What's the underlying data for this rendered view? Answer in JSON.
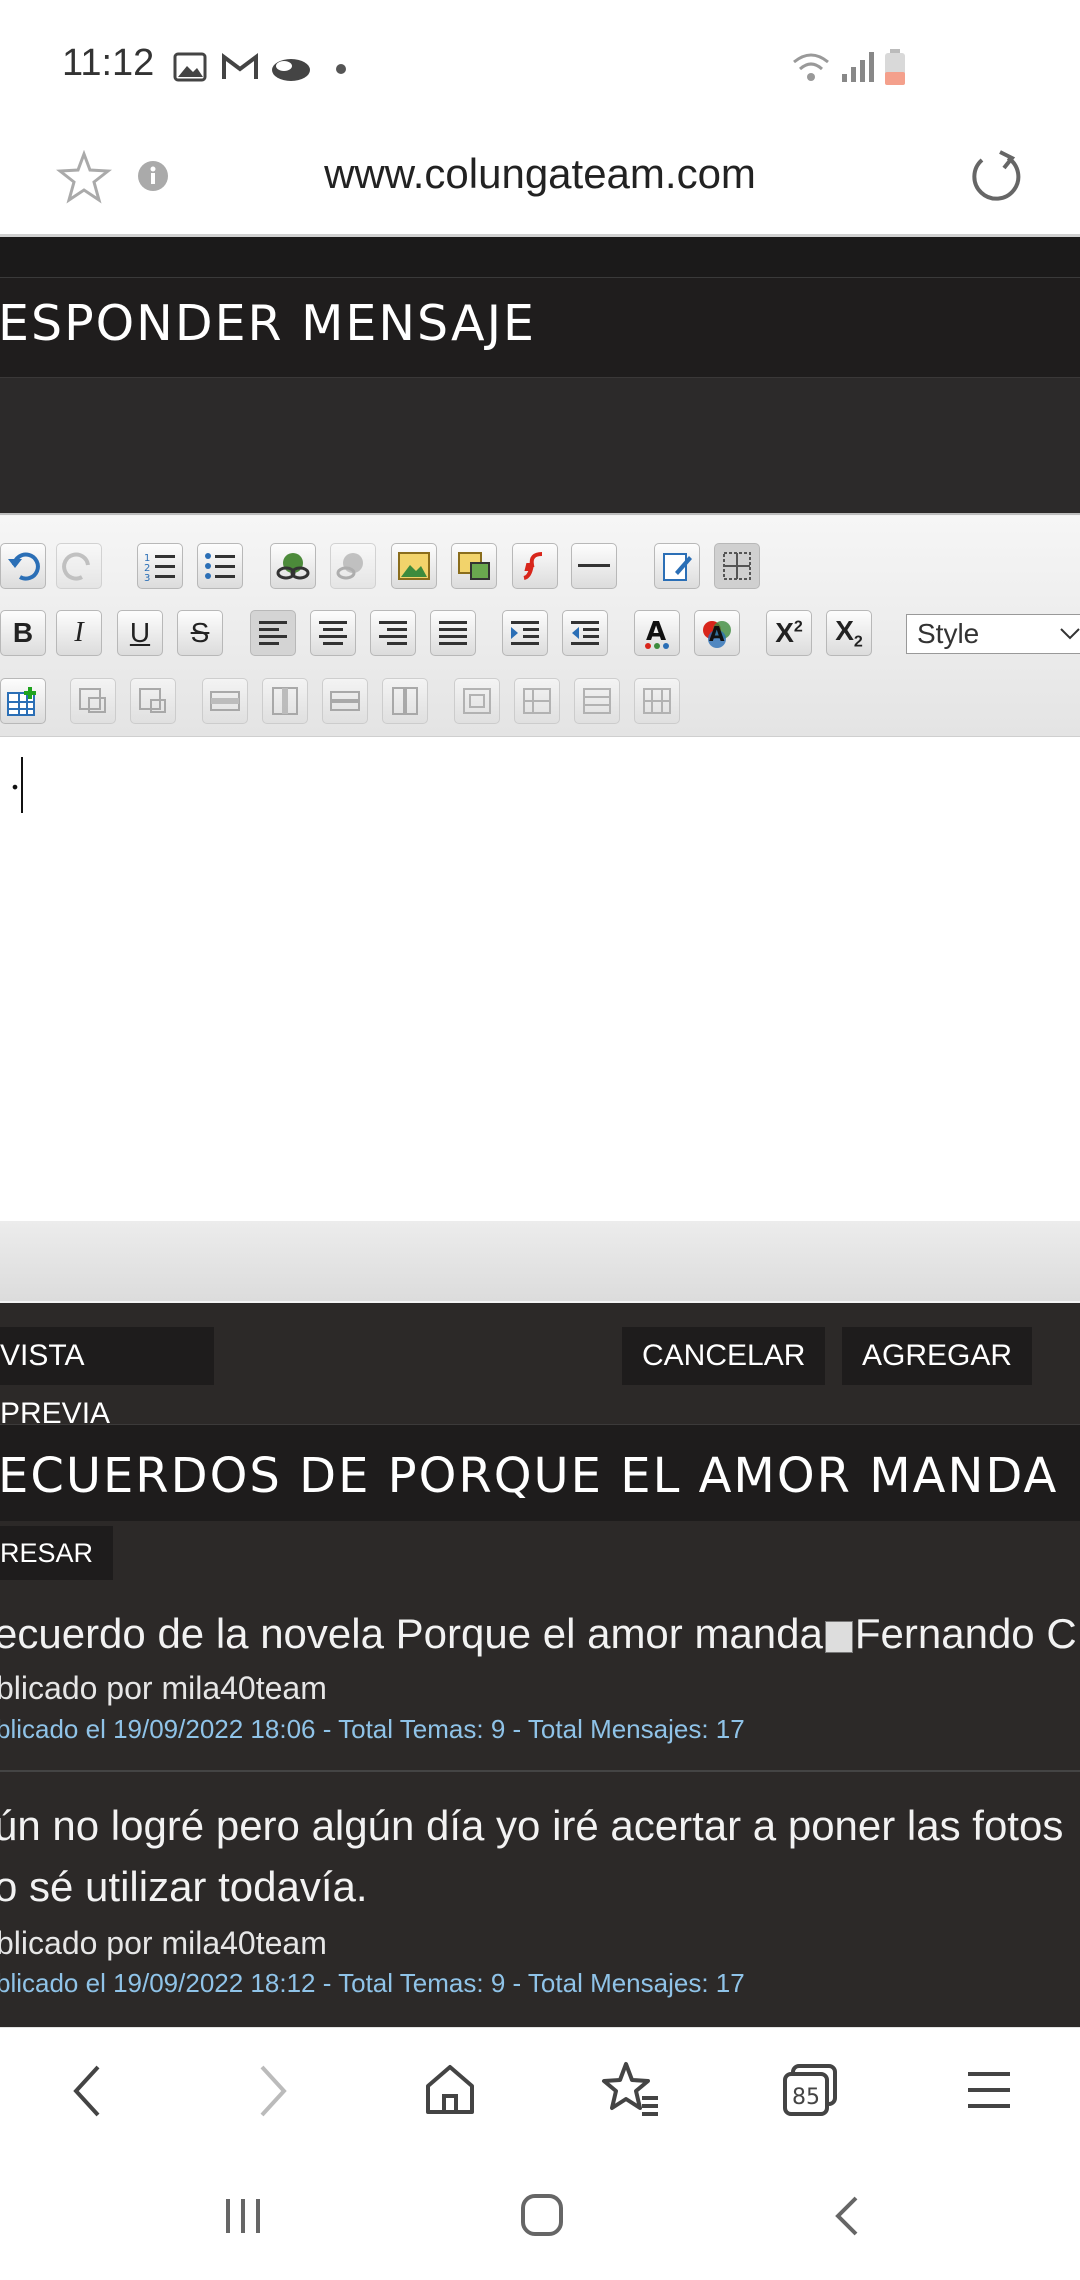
{
  "status_bar": {
    "time": "11:12",
    "notification_icons": [
      "image-icon",
      "gmail-icon",
      "cloud-icon",
      "dot-icon"
    ],
    "right_icons": [
      "wifi-icon",
      "signal-icon",
      "battery-icon"
    ]
  },
  "url_bar": {
    "url": "www.colungateam.com",
    "left_icons": [
      "bookmark-star-icon",
      "info-icon"
    ],
    "right_icon": "reload-icon"
  },
  "reply": {
    "title": "ESPONDER MENSAJE"
  },
  "editor": {
    "style_select_value": "Style",
    "content": "."
  },
  "buttons": {
    "preview": "VISTA PREVIA",
    "cancel": "CANCELAR",
    "add": "AGREGAR"
  },
  "thread": {
    "title": "ECUERDOS DE PORQUE EL AMOR MANDA",
    "enter_button": "RESAR",
    "posts": [
      {
        "text_line1": "ecuerdo de la novela Porque el amor manda",
        "image_alt": "Fernando C",
        "author": "blicado por mila40team",
        "meta": "blicado el 19/09/2022 18:06 - Total Temas: 9 - Total Mensajes: 17"
      },
      {
        "text_line1": "ún no logré pero algún día yo iré acertar a poner las fotos",
        "text_line2": "o sé utilizar todavía.",
        "author": "blicado por mila40team",
        "meta": "blicado el 19/09/2022 18:12 - Total Temas: 9 - Total Mensajes: 17"
      }
    ]
  },
  "browser_nav": {
    "tab_count": "85"
  }
}
